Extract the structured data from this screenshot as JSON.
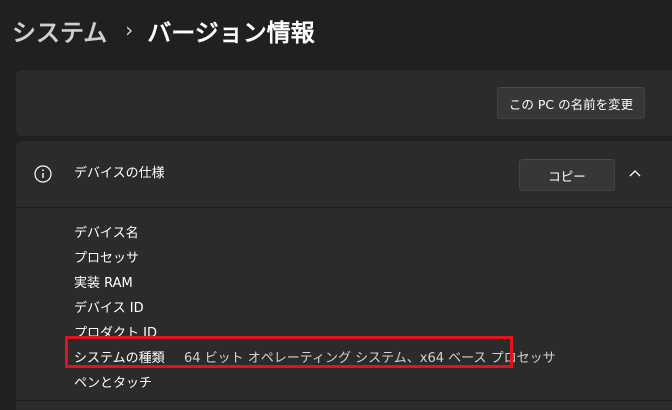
{
  "breadcrumb": {
    "parent": "システム",
    "separator": "›",
    "current": "バージョン情報"
  },
  "rename_card": {
    "button_label": "この PC の名前を変更"
  },
  "device_spec": {
    "icon": "info-icon",
    "title": "デバイスの仕様",
    "copy_label": "コピー",
    "chevron_icon": "chevron-up-icon",
    "rows": [
      {
        "label": "デバイス名",
        "value": ""
      },
      {
        "label": "プロセッサ",
        "value": ""
      },
      {
        "label": "実装 RAM",
        "value": ""
      },
      {
        "label": "デバイス ID",
        "value": ""
      },
      {
        "label": "プロダクト ID",
        "value": ""
      },
      {
        "label": "システムの種類",
        "value": "64 ビット オペレーティング システム、x64 ベース プロセッサ"
      },
      {
        "label": "ペンとタッチ",
        "value": ""
      }
    ]
  },
  "colors": {
    "background": "#202020",
    "card": "#2b2b2b",
    "button": "#373737",
    "highlight": "#e0141e"
  }
}
